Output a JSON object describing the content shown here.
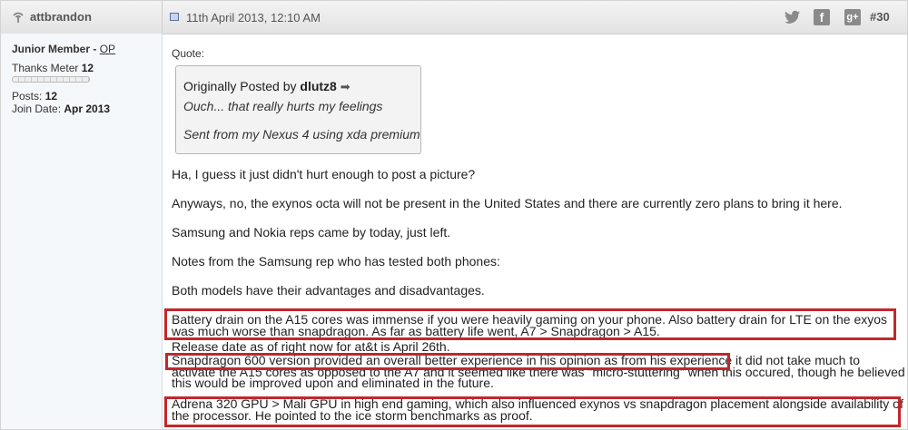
{
  "header": {
    "username": "attbrandon",
    "date": "11th April 2013, 12:10 AM",
    "post_number": "#30",
    "social": {
      "facebook": "f",
      "googleplus": "g+"
    }
  },
  "user": {
    "title": "Junior Member -",
    "op_label": "OP",
    "thanks_label": "Thanks Meter",
    "thanks_value": "12",
    "posts_label": "Posts:",
    "posts_value": "12",
    "join_label": "Join Date:",
    "join_value": "Apr 2013"
  },
  "quote": {
    "label": "Quote:",
    "posted_by_prefix": "Originally Posted by",
    "author": "dlutz8",
    "line1": "Ouch... that really hurts my feelings",
    "line2": "Sent from my Nexus 4 using xda premium"
  },
  "body": {
    "p1": "Ha, I guess it just didn't hurt enough to post a picture?",
    "p2": "Anyways, no, the exynos octa will not be present in the United States and there are currently zero plans to bring it here.",
    "p3": "Samsung and Nokia reps came by today, just left.",
    "p4": "Notes from the Samsung rep who has tested both phones:",
    "p5": "Both models have their advantages and disadvantages.",
    "t1": "Battery drain on the A15 cores was immense if you were heavily gaming on your phone. Also battery drain for LTE on the exyos was much worse than snapdragon. As far as battery life went, A7 > Snapdragon > A15.",
    "t2": "Release date as of right now for at&t is April 26th.",
    "t3": "Snapdragon 600 version provided an overall better experience in his opinion as from his experience it did not take much to activate the A15 cores as opposed to the A7 and it seemed like there was \"micro-stuttering\" when this occured, though he believed this would be improved upon and eliminated in the future.",
    "t4": "Adrena 320 GPU > Mali GPU in high end gaming, which also influenced exynos vs snapdragon placement alongside availability of the processor. He pointed to the ice storm benchmarks as proof."
  },
  "colors": {
    "highlight": "#c1272d",
    "header_bg": "#e8e8e8",
    "sidebar_bg": "#f5f8fa"
  }
}
